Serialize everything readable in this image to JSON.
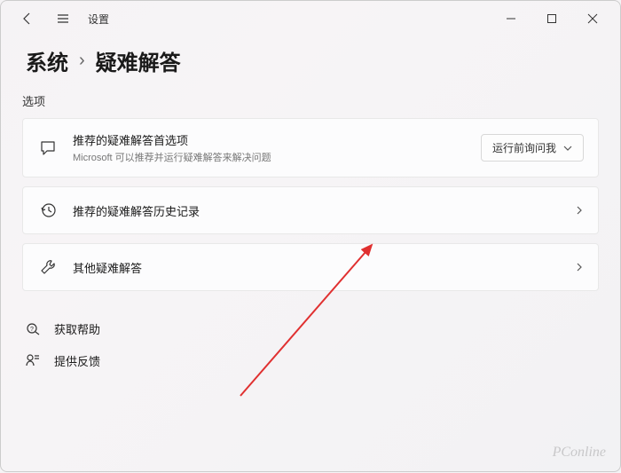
{
  "app": {
    "title": "设置"
  },
  "breadcrumb": {
    "parent": "系统",
    "current": "疑难解答"
  },
  "section": {
    "label": "选项"
  },
  "cards": {
    "pref": {
      "title": "推荐的疑难解答首选项",
      "subtitle": "Microsoft 可以推荐并运行疑难解答来解决问题",
      "dropdown_value": "运行前询问我"
    },
    "history": {
      "title": "推荐的疑难解答历史记录"
    },
    "other": {
      "title": "其他疑难解答"
    }
  },
  "links": {
    "help": "获取帮助",
    "feedback": "提供反馈"
  },
  "watermark": "PConline"
}
